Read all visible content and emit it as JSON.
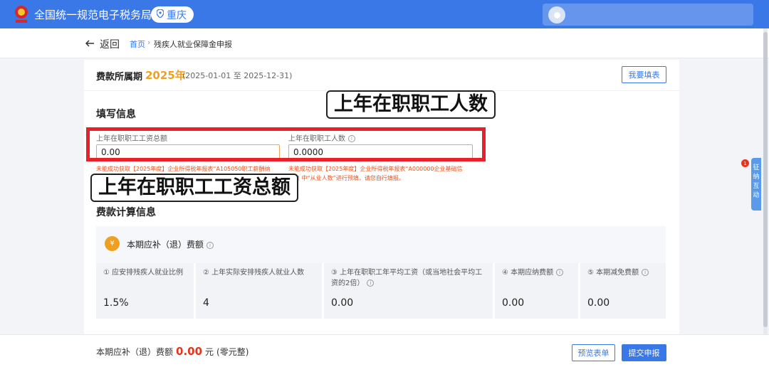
{
  "header": {
    "title": "全国统一规范电子税务局",
    "region": "重庆"
  },
  "nav": {
    "back": "返回",
    "breadcrumb_home": "首页",
    "breadcrumb_sep": "›",
    "breadcrumb_current": "残疾人就业保障金申报"
  },
  "period": {
    "label": "费款所属期",
    "year": "2025年",
    "range": "(2025-01-01 至 2025-12-31)",
    "fill_button": "我要填表"
  },
  "fill_section": {
    "title": "填写信息",
    "total_wage_label": "上年在职职工工资总额",
    "total_wage_value": "0.00",
    "employee_count_label": "上年在职职工人数",
    "employee_count_value": "0.0000",
    "hint_left_1": "未能成功获取【2025年度】企业所得税年报表“A105050职工薪酬纳",
    "hint_right_1": "未能成功获取【2025年度】企业所得税年报表“A000000企业基础信",
    "hint_right_2": "息表 中“从业人数”进行预填，请您自行填报。"
  },
  "calc_section": {
    "title": "费款计算信息",
    "summary_label": "本期应补（退）费额",
    "coin_symbol": "¥",
    "columns": [
      {
        "label": "① 应安排残疾人就业比例",
        "value": "1.5%"
      },
      {
        "label": "② 上年实际安排残疾人就业人数",
        "value": "4"
      },
      {
        "label": "③ 上年在职职工年平均工资（或当地社会平均工资的2倍）",
        "value": "0.00"
      },
      {
        "label": "④ 本期应纳费额",
        "value": "0.00"
      },
      {
        "label": "⑤ 本期减免费额",
        "value": "0.00"
      }
    ]
  },
  "footer": {
    "label": "本期应补（退）费额",
    "amount": "0.00",
    "unit": "元",
    "amount_words": "(零元整)",
    "preview_button": "预览表单",
    "submit_button": "提交申报"
  },
  "side": {
    "tab_text": "征纳互动",
    "badge_count": "1"
  },
  "annotations": {
    "employee_count_callout": "上年在职职工人数",
    "total_wage_callout": "上年在职职工工资总额"
  },
  "colors": {
    "brand_blue": "#3a78e8",
    "accent_orange": "#f0a020",
    "highlight_red": "#e8202a"
  }
}
